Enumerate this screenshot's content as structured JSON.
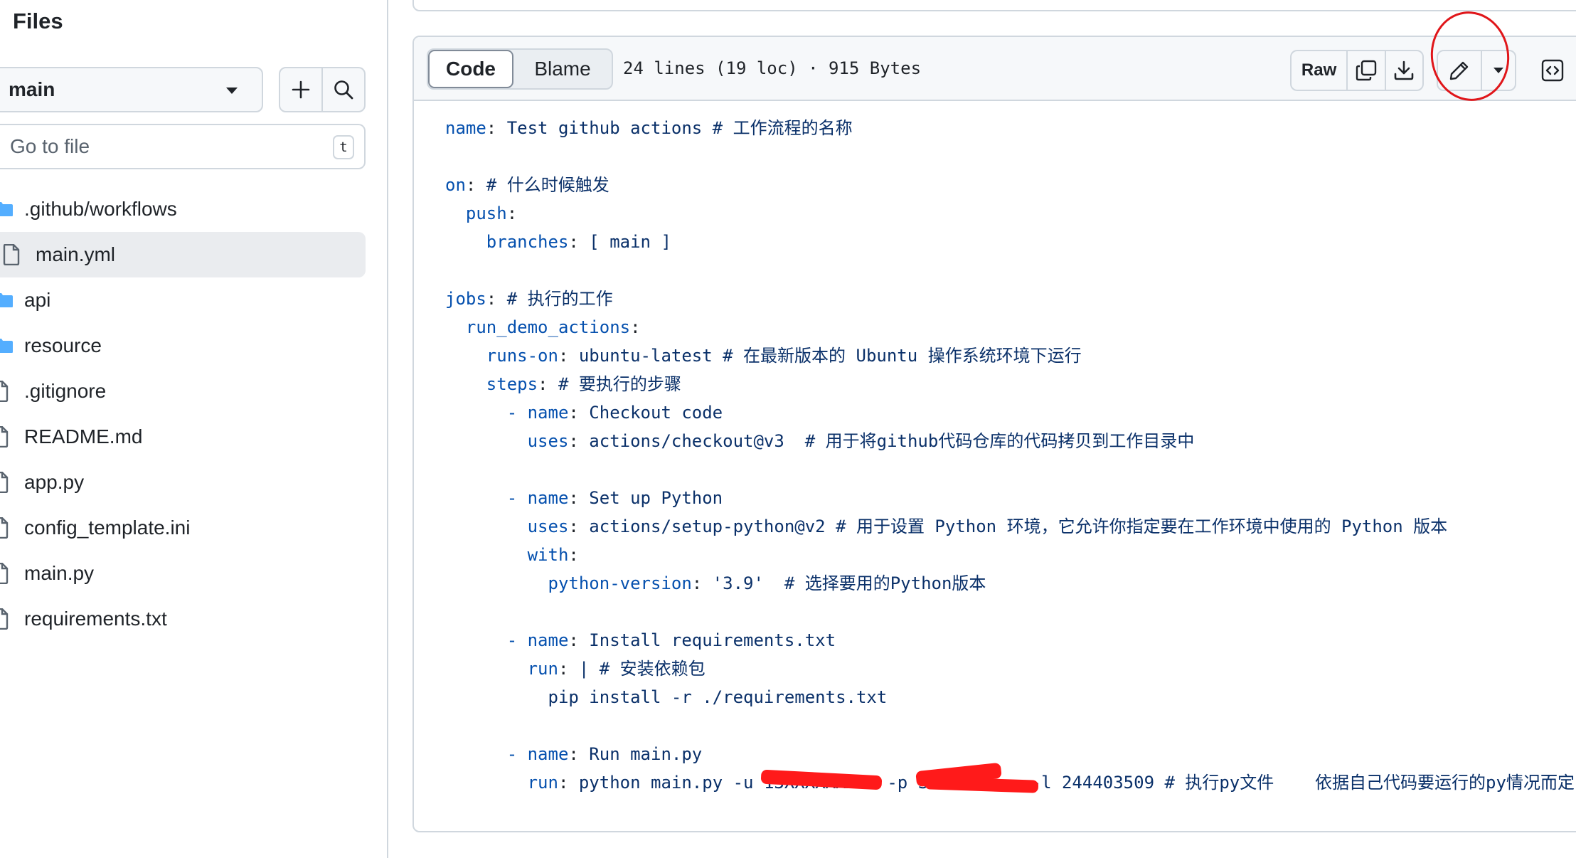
{
  "sidebar": {
    "title": "Files",
    "branch": "main",
    "goto_placeholder": "Go to file",
    "goto_shortcut": "t",
    "items": [
      {
        "label": ".github/workflows",
        "type": "folder"
      },
      {
        "label": "main.yml",
        "type": "file",
        "selected": true
      },
      {
        "label": "api",
        "type": "folder"
      },
      {
        "label": "resource",
        "type": "folder"
      },
      {
        "label": ".gitignore",
        "type": "file"
      },
      {
        "label": "README.md",
        "type": "file"
      },
      {
        "label": "app.py",
        "type": "file"
      },
      {
        "label": "config_template.ini",
        "type": "file"
      },
      {
        "label": "main.py",
        "type": "file"
      },
      {
        "label": "requirements.txt",
        "type": "file"
      }
    ]
  },
  "file_header": {
    "tab_code": "Code",
    "tab_blame": "Blame",
    "meta": "24 lines (19 loc) · 915 Bytes",
    "raw_label": "Raw"
  },
  "code_lines": [
    {
      "key": "name",
      "rest": " Test github actions # 工作流程的名称"
    },
    {
      "key": "",
      "rest": ""
    },
    {
      "key": "on",
      "rest": " # 什么时候触发"
    },
    {
      "key": "  push",
      "rest": ""
    },
    {
      "key": "    branches",
      "rest": " [ main ]"
    },
    {
      "key": "",
      "rest": ""
    },
    {
      "key": "jobs",
      "rest": " # 执行的工作"
    },
    {
      "key": "  run_demo_actions",
      "rest": ""
    },
    {
      "key": "    runs-on",
      "rest": " ubuntu-latest # 在最新版本的 Ubuntu 操作系统环境下运行"
    },
    {
      "key": "    steps",
      "rest": " # 要执行的步骤"
    },
    {
      "pre": "      - ",
      "key": "name",
      "rest": " Checkout code"
    },
    {
      "key": "        uses",
      "rest": " actions/checkout@v3  # 用于将github代码仓库的代码拷贝到工作目录中"
    },
    {
      "key": "",
      "rest": ""
    },
    {
      "pre": "      - ",
      "key": "name",
      "rest": " Set up Python"
    },
    {
      "key": "        uses",
      "rest": " actions/setup-python@v2 # 用于设置 Python 环境，它允许你指定要在工作环境中使用的 Python 版本"
    },
    {
      "key": "        with",
      "rest": ""
    },
    {
      "key": "          python-version",
      "rest": " '3.9'  # 选择要用的Python版本"
    },
    {
      "key": "",
      "rest": ""
    },
    {
      "pre": "      - ",
      "key": "name",
      "rest": " Install requirements.txt"
    },
    {
      "key": "        run",
      "rest": " | # 安装依赖包"
    },
    {
      "key": "",
      "rest": "          pip install -r ./requirements.txt"
    },
    {
      "key": "",
      "rest": ""
    },
    {
      "pre": "      - ",
      "key": "name",
      "rest": " Run main.py"
    },
    {
      "key": "        run",
      "rest": " python main.py -u 13XXXXXXX15 -p S          -l 244403509 # 执行py文件    依据自己代码要运行的py情况而定"
    }
  ]
}
